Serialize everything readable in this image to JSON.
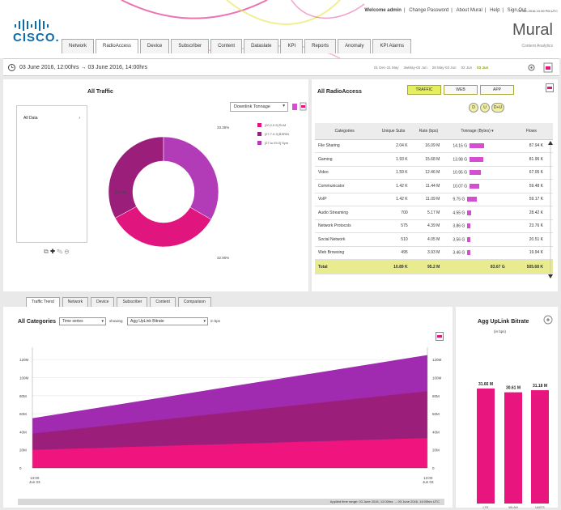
{
  "header": {
    "logo_text": "CISCO.",
    "top_links": [
      "Welcome admin",
      "Change Password",
      "About Mural",
      "Help",
      "Sign Out"
    ],
    "top_date": "03 Jun 2016 10:39 PM UTC",
    "brand": "Mural",
    "brand_sub": "Content Analytics"
  },
  "tabs": [
    {
      "label": "Network",
      "active": false
    },
    {
      "label": "RadioAccess",
      "active": true
    },
    {
      "label": "Device",
      "active": false
    },
    {
      "label": "Subscriber",
      "active": false
    },
    {
      "label": "Content",
      "active": false
    },
    {
      "label": "Dataslate",
      "active": false
    },
    {
      "label": "KPI",
      "active": false
    },
    {
      "label": "Reports",
      "active": false
    },
    {
      "label": "Anomaly",
      "active": false
    },
    {
      "label": "KPI Alarms",
      "active": false
    }
  ],
  "datebar": {
    "range": "03 June 2016, 12:00hrs → 03 June 2016, 14:00hrs",
    "quick": [
      "01 Dec-31 May",
      "3wMay-02 Jun",
      "28 May-03 Jun",
      "02 Jun",
      "03 Jun"
    ],
    "quick_active": "03 Jun"
  },
  "all_traffic": {
    "title": "All Traffic",
    "left_list_item": "All Data",
    "dropdown": "Downlink Tonnage",
    "pct_labels": [
      "33.35%",
      "33.74%",
      "32.90%"
    ],
    "legend": [
      {
        "label": "[20.2.0.5] RLM",
        "color": "#e0157e"
      },
      {
        "label": "[27.7.0.3] BSRIN",
        "color": "#9b1f7a"
      },
      {
        "label": "[27.to 03.0] Sym",
        "color": "#b23cb8"
      }
    ],
    "chart_data": {
      "type": "pie",
      "categories": [
        "[20.2.0.5] RLM",
        "[27.7.0.3] BSRIN",
        "[27.to 03.0] Sym"
      ],
      "values": [
        33.74,
        32.9,
        33.35
      ]
    }
  },
  "radio": {
    "title": "All RadioAccess",
    "buttons": [
      "TRAFFIC",
      "WEB",
      "APP"
    ],
    "circles": [
      "D",
      "U",
      "D+U"
    ],
    "columns": [
      "Categories",
      "Unique Subs",
      "Rate (bps)",
      "Tonnage (Bytes)",
      "Flows"
    ],
    "rows": [
      {
        "cat": "File Sharing",
        "subs": "2.04 K",
        "rate": "16.09 M",
        "ton": "14.16 G",
        "flows": "87.94 K",
        "bar": 1.0
      },
      {
        "cat": "Gaming",
        "subs": "1.93 K",
        "rate": "15.68 M",
        "ton": "13.98 G",
        "flows": "81.96 K",
        "bar": 0.95
      },
      {
        "cat": "Video",
        "subs": "1.59 K",
        "rate": "12.46 M",
        "ton": "10.95 G",
        "flows": "67.05 K",
        "bar": 0.75
      },
      {
        "cat": "Communicator",
        "subs": "1.42 K",
        "rate": "11.44 M",
        "ton": "10.07 G",
        "flows": "59.48 K",
        "bar": 0.68
      },
      {
        "cat": "VoIP",
        "subs": "1.42 K",
        "rate": "11.09 M",
        "ton": "9.75 G",
        "flows": "59.17 K",
        "bar": 0.66
      },
      {
        "cat": "Audio Streaming",
        "subs": "700",
        "rate": "5.17 M",
        "ton": "4.55 G",
        "flows": "28.42 K",
        "bar": 0.28
      },
      {
        "cat": "Network Protocols",
        "subs": "575",
        "rate": "4.39 M",
        "ton": "3.86 G",
        "flows": "23.76 K",
        "bar": 0.22
      },
      {
        "cat": "Social Network",
        "subs": "510",
        "rate": "4.05 M",
        "ton": "3.56 G",
        "flows": "20.51 K",
        "bar": 0.2
      },
      {
        "cat": "Web Browsing",
        "subs": "495",
        "rate": "3.93 M",
        "ton": "3.46 G",
        "flows": "19.94 K",
        "bar": 0.19
      }
    ],
    "total": {
      "cat": "Total",
      "subs": "10.89 K",
      "rate": "95.2 M",
      "ton": "83.67 G",
      "flows": "505.68 K"
    }
  },
  "bottom_tabs": [
    "Traffic Trend",
    "Network",
    "Device",
    "Subscriber",
    "Content",
    "Comparison"
  ],
  "trend": {
    "title": "All Categories",
    "select1": "Time series",
    "showing": "showing",
    "select2": "Agg UpLink Bitrate",
    "unit": "in bps",
    "y_ticks": [
      "120M",
      "100M",
      "80M",
      "60M",
      "40M",
      "20M",
      "0"
    ],
    "x_start": "13:00",
    "x_start_sub": "Jun 03",
    "x_end": "13:00",
    "x_end_sub": "Jun 03",
    "footer": "Applied time range: 03 June 2016, 12:00hrs → 03 June 2016, 14:00hrs UTC",
    "chart_data": {
      "type": "area",
      "x": [
        "start",
        "end"
      ],
      "series": [
        {
          "name": "",
          "values": [
            20,
            33
          ],
          "color": "#f0157e"
        },
        {
          "name": "",
          "values": [
            38,
            85
          ],
          "color": "#9b1f7a"
        },
        {
          "name": "",
          "values": [
            55,
            125
          ],
          "color": "#a02bb0"
        }
      ],
      "ylim": [
        0,
        130
      ]
    }
  },
  "agg": {
    "title": "Agg UpLink Bitrate",
    "unit": "(in bps)",
    "chart_data": {
      "type": "bar",
      "categories": [
        "LTE",
        "WLAN",
        "UMTS"
      ],
      "values": [
        31.66,
        30.61,
        31.18
      ],
      "labels": [
        "31.66 M",
        "30.61 M",
        "31.18 M"
      ],
      "ylim": [
        0,
        45
      ]
    }
  }
}
